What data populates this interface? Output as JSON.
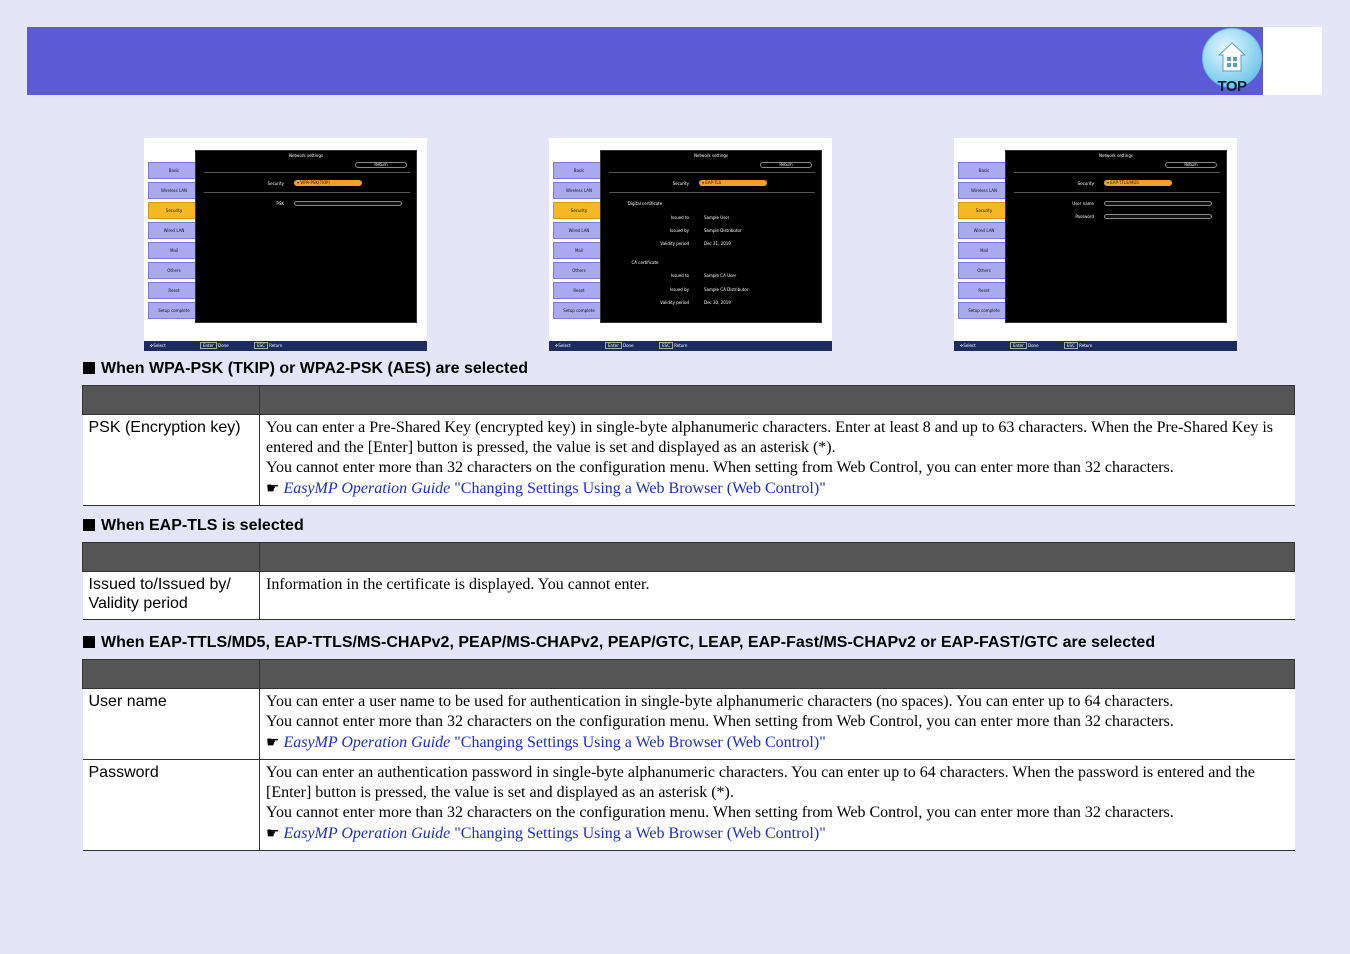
{
  "top_button": {
    "label": "TOP"
  },
  "screenshots": [
    {
      "title": "Network settings",
      "return_label": "Return",
      "tabs": [
        "Basic",
        "Wireless LAN",
        "Security",
        "Wired LAN",
        "Mail",
        "Others",
        "Reset",
        "Setup complete"
      ],
      "active_tab": "Security",
      "security_label": "Security",
      "security_value": "WPA-PSK(TKIP)",
      "fields": [
        "PSK"
      ],
      "footer": {
        "select": "Select",
        "enter": "Enter",
        "done": "Done",
        "esc": "ESC",
        "return": "Return"
      }
    },
    {
      "title": "Network settings",
      "return_label": "Return",
      "tabs": [
        "Basic",
        "Wireless LAN",
        "Security",
        "Wired LAN",
        "Mail",
        "Others",
        "Reset",
        "Setup complete"
      ],
      "active_tab": "Security",
      "security_label": "Security",
      "security_value": "EAP-TLS",
      "digital_cert": {
        "heading": "Digital certificate",
        "issued_to_label": "Issued to",
        "issued_to": "Sample User",
        "issued_by_label": "Issued by",
        "issued_by": "Sample Distributor",
        "validity_label": "Validity period",
        "validity": "Dec 31, 2019"
      },
      "ca_cert": {
        "heading": "CA certificate",
        "issued_to_label": "Issued to",
        "issued_to": "Sample CA User",
        "issued_by_label": "Issued by",
        "issued_by": "Sample CA Distributor",
        "validity_label": "Validity period",
        "validity": "Dec 30, 2019"
      },
      "footer": {
        "select": "Select",
        "enter": "Enter",
        "done": "Done",
        "esc": "ESC",
        "return": "Return"
      }
    },
    {
      "title": "Network settings",
      "return_label": "Return",
      "tabs": [
        "Basic",
        "Wireless LAN",
        "Security",
        "Wired LAN",
        "Mail",
        "Others",
        "Reset",
        "Setup complete"
      ],
      "active_tab": "Security",
      "security_label": "Security",
      "security_value": "EAP-TTLS/MD5",
      "fields": [
        "User name",
        "Password"
      ],
      "footer": {
        "select": "Select",
        "enter": "Enter",
        "done": "Done",
        "esc": "ESC",
        "return": "Return"
      }
    }
  ],
  "sections": [
    {
      "title": "When WPA-PSK (TKIP) or WPA2-PSK (AES) are selected",
      "rows": [
        {
          "name": "PSK (Encryption key)",
          "lines": [
            "You can enter a Pre-Shared Key (encrypted key) in single-byte alphanumeric characters. Enter at least 8 and up to 63 characters. When the Pre-Shared Key is entered and the [Enter] button is pressed, the value is set and displayed as an asterisk (*).",
            "You cannot enter more than 32 characters on the configuration menu. When setting from Web Control, you can enter more than 32 characters."
          ],
          "ref": {
            "guide": "EasyMP Operation Guide",
            "link": "\"Changing Settings Using a Web Browser (Web Control)\""
          }
        }
      ]
    },
    {
      "title": "When EAP-TLS is selected",
      "rows": [
        {
          "name": "Issued to/Issued by/ Validity period",
          "lines": [
            "Information in the certificate is displayed. You cannot enter."
          ]
        }
      ]
    },
    {
      "title": "When EAP-TTLS/MD5, EAP-TTLS/MS-CHAPv2, PEAP/MS-CHAPv2, PEAP/GTC, LEAP, EAP-Fast/MS-CHAPv2 or EAP-FAST/GTC are selected",
      "rows": [
        {
          "name": "User name",
          "lines": [
            "You can enter a user name to be used for authentication in single-byte alphanumeric characters (no spaces). You can enter up to 64 characters.",
            "You cannot enter more than 32 characters on the configuration menu. When setting from Web Control, you can enter more than 32 characters."
          ],
          "ref": {
            "guide": "EasyMP Operation Guide",
            "link": "\"Changing Settings Using a Web Browser (Web Control)\""
          }
        },
        {
          "name": "Password",
          "lines": [
            "You can enter an authentication password in single-byte alphanumeric characters. You can enter up to 64 characters. When the password is entered and the [Enter] button is pressed, the value is set and displayed as an asterisk (*).",
            "You cannot enter more than 32 characters on the configuration menu. When setting from Web Control, you can enter more than 32 characters."
          ],
          "ref": {
            "guide": "EasyMP Operation Guide",
            "link": "\"Changing Settings Using a Web Browser (Web Control)\""
          }
        }
      ]
    }
  ]
}
